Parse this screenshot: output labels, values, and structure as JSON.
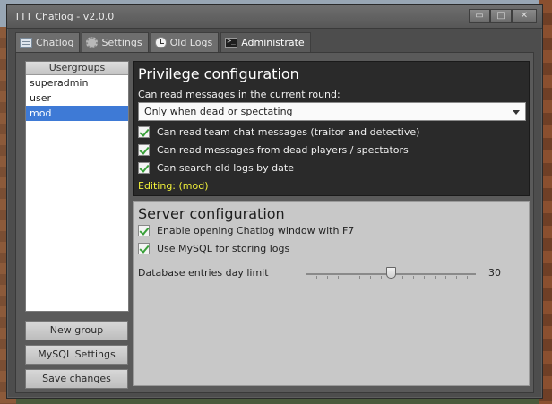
{
  "window": {
    "title": "TTT Chatlog - v2.0.0",
    "minimize_label": "▭",
    "maximize_label": "□",
    "close_label": "✕"
  },
  "tabs": [
    {
      "label": "Chatlog",
      "icon": "document-icon"
    },
    {
      "label": "Settings",
      "icon": "gear-icon"
    },
    {
      "label": "Old Logs",
      "icon": "clock-icon"
    },
    {
      "label": "Administrate",
      "icon": "console-icon",
      "active": true
    }
  ],
  "usergroups": {
    "header": "Usergroups",
    "items": [
      "superadmin",
      "user",
      "mod"
    ],
    "selected": "mod"
  },
  "buttons": {
    "new_group": "New group",
    "mysql_settings": "MySQL Settings",
    "save_changes": "Save changes"
  },
  "privilege": {
    "title": "Privilege configuration",
    "read_label": "Can read messages in the current round:",
    "read_selected": "Only when dead or spectating",
    "checkboxes": [
      {
        "label": "Can read team chat messages (traitor and detective)",
        "checked": true
      },
      {
        "label": "Can read messages from dead players / spectators",
        "checked": true
      },
      {
        "label": "Can search old logs by date",
        "checked": true
      }
    ],
    "editing": "Editing: (mod)"
  },
  "server": {
    "title": "Server configuration",
    "checkboxes": [
      {
        "label": "Enable opening Chatlog window with F7",
        "checked": true
      },
      {
        "label": "Use MySQL for storing logs",
        "checked": true
      }
    ],
    "slider_label": "Database entries day limit",
    "slider_value": "30",
    "slider_fraction": 0.5
  },
  "colors": {
    "selection": "#3e7ad6",
    "editing_text": "#f2f23a",
    "check": "#3aa03a"
  }
}
